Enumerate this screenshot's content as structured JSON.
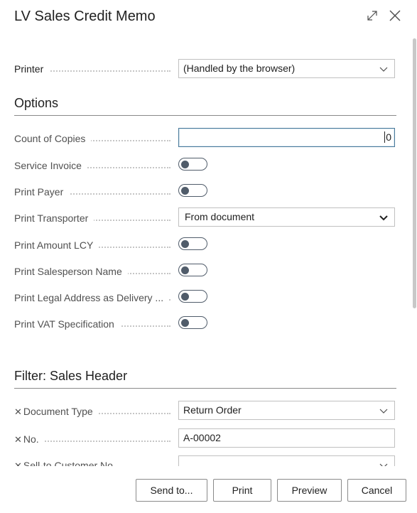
{
  "dialog": {
    "title": "LV Sales Credit Memo"
  },
  "printer": {
    "label": "Printer",
    "value": "(Handled by the browser)"
  },
  "options": {
    "heading": "Options",
    "count_of_copies": {
      "label": "Count of Copies",
      "value": "0"
    },
    "service_invoice": {
      "label": "Service Invoice",
      "checked": false
    },
    "print_payer": {
      "label": "Print Payer",
      "checked": false
    },
    "print_transporter": {
      "label": "Print Transporter",
      "value": "From document"
    },
    "print_amount_lcy": {
      "label": "Print Amount LCY",
      "checked": false
    },
    "print_salesperson_name": {
      "label": "Print Salesperson Name",
      "checked": false
    },
    "print_legal_address": {
      "label": "Print Legal Address as Delivery ...",
      "checked": false
    },
    "print_vat_spec": {
      "label": "Print VAT Specification",
      "checked": false
    }
  },
  "filter": {
    "heading": "Filter: Sales Header",
    "document_type": {
      "label": "Document Type",
      "value": "Return Order"
    },
    "no": {
      "label": "No.",
      "value": "A-00002"
    },
    "sell_to_customer_no": {
      "label": "Sell-to Customer No.",
      "value": ""
    }
  },
  "footer": {
    "send_to": "Send to...",
    "print": "Print",
    "preview": "Preview",
    "cancel": "Cancel"
  }
}
